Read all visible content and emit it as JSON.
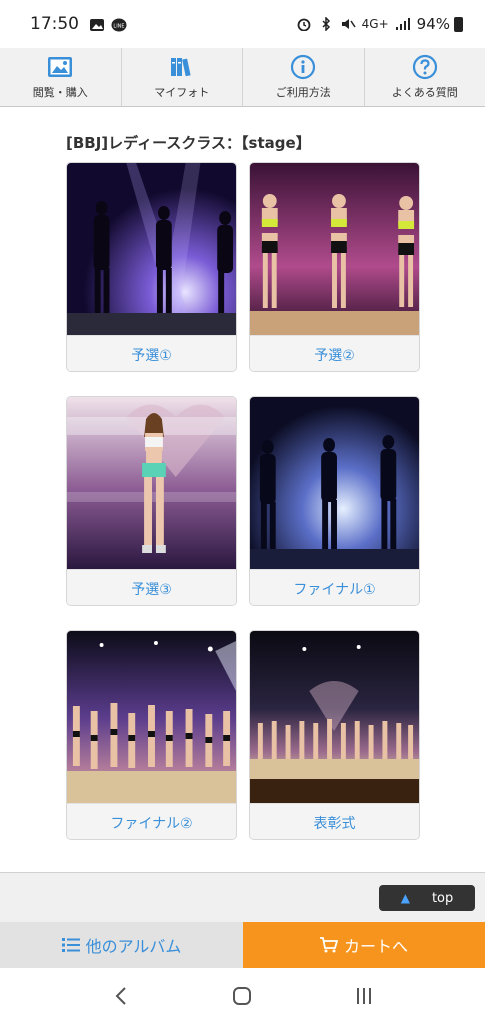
{
  "status": {
    "time": "17:50",
    "network": "4G+",
    "battery": "94%"
  },
  "nav": {
    "items": [
      {
        "label": "閲覧・購入",
        "icon": "image-icon"
      },
      {
        "label": "マイフォト",
        "icon": "books-icon"
      },
      {
        "label": "ご利用方法",
        "icon": "info-icon"
      },
      {
        "label": "よくある質問",
        "icon": "question-icon"
      }
    ]
  },
  "section": {
    "title": "[BBJ]レディースクラス：【stage】"
  },
  "albums": [
    {
      "label": "予選①"
    },
    {
      "label": "予選②"
    },
    {
      "label": "予選③"
    },
    {
      "label": "ファイナル①"
    },
    {
      "label": "ファイナル②"
    },
    {
      "label": "表彰式"
    }
  ],
  "footer": {
    "top_label": "top",
    "other_albums_label": "他のアルバム",
    "cart_label": "カートへ"
  },
  "colors": {
    "accent": "#3a8fd9",
    "cart": "#f7941d"
  }
}
